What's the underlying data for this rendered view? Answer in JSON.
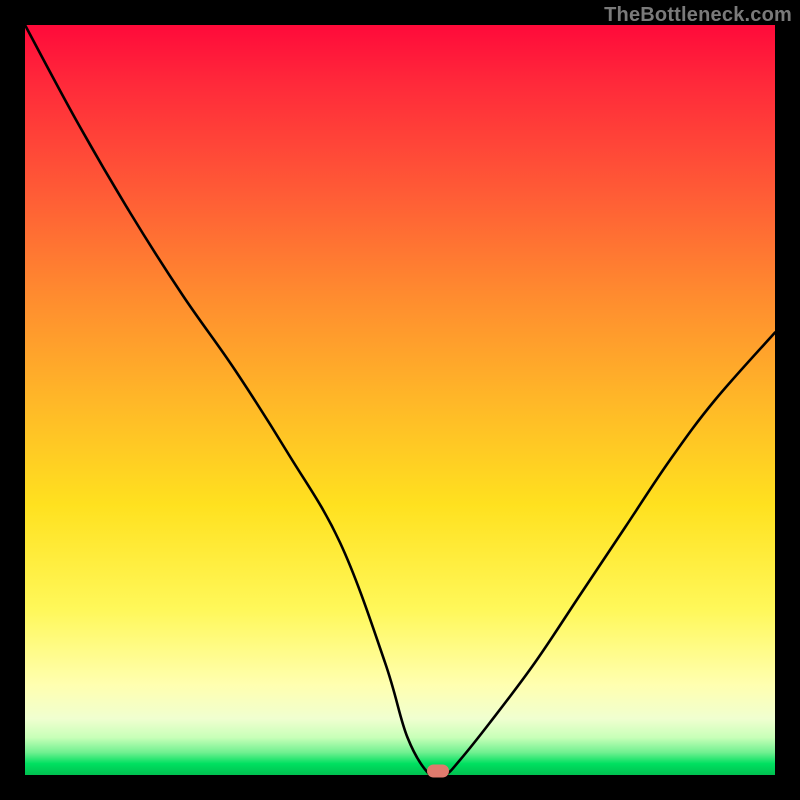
{
  "watermark": "TheBottleneck.com",
  "colors": {
    "frame": "#000000",
    "marker": "#df7a6d",
    "curve": "#000000"
  },
  "chart_data": {
    "type": "line",
    "title": "",
    "xlabel": "",
    "ylabel": "",
    "xlim": [
      0,
      100
    ],
    "ylim": [
      0,
      100
    ],
    "grid": false,
    "legend": false,
    "annotations": [],
    "series": [
      {
        "name": "bottleneck-curve",
        "x": [
          0,
          7,
          14,
          21,
          28,
          35,
          42,
          48,
          51,
          54,
          56,
          58,
          62,
          68,
          74,
          80,
          86,
          92,
          100
        ],
        "values": [
          100,
          87,
          75,
          64,
          54,
          43,
          31,
          15,
          5,
          0,
          0,
          2,
          7,
          15,
          24,
          33,
          42,
          50,
          59
        ]
      }
    ],
    "marker": {
      "x": 55,
      "y": 0
    },
    "background_gradient": {
      "top": "#ff0a3a",
      "upper_mid": "#ff8b2f",
      "mid": "#ffe11f",
      "lower_mid": "#ffffb0",
      "bottom": "#00c050"
    }
  }
}
